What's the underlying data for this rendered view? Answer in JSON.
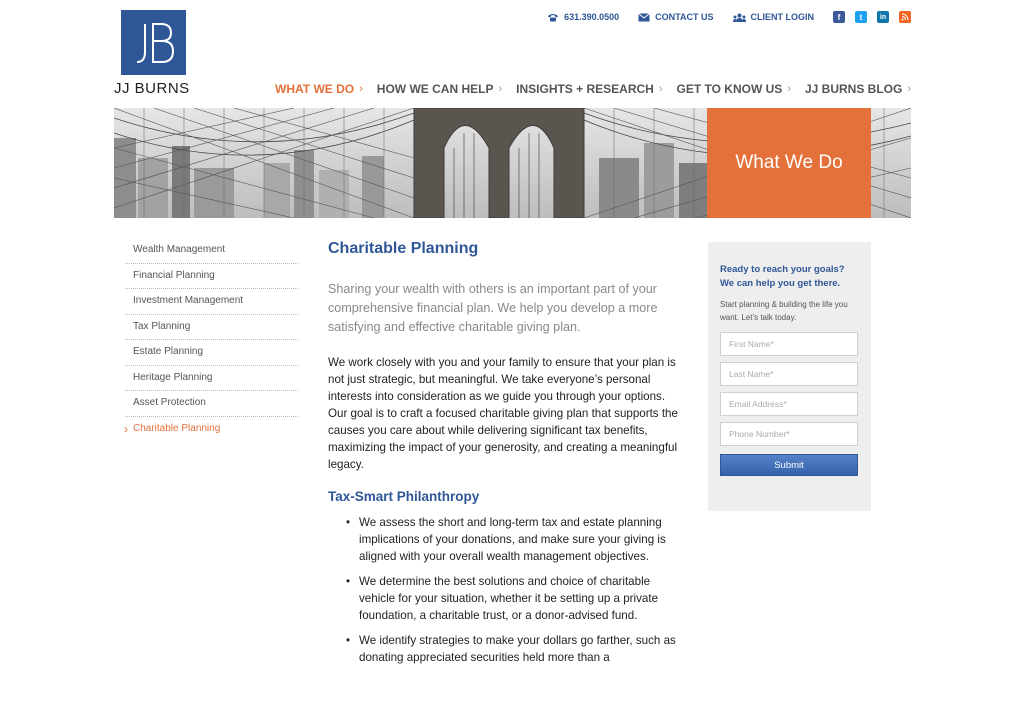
{
  "brand": {
    "name": "JJ BURNS"
  },
  "utility": {
    "phone": "631.390.0500",
    "contact": "CONTACT US",
    "client_login": "CLIENT LOGIN"
  },
  "nav": [
    {
      "label": "WHAT WE DO",
      "active": true
    },
    {
      "label": "HOW WE CAN HELP"
    },
    {
      "label": "INSIGHTS + RESEARCH"
    },
    {
      "label": "GET TO KNOW US"
    },
    {
      "label": "JJ BURNS BLOG"
    }
  ],
  "hero": {
    "title": "What We Do"
  },
  "sidebar": [
    "Wealth Management",
    "Financial Planning",
    "Investment Management",
    "Tax Planning",
    "Estate Planning",
    "Heritage Planning",
    "Asset Protection",
    "Charitable Planning"
  ],
  "content": {
    "title": "Charitable Planning",
    "intro": "Sharing your wealth with others is an important part of your comprehensive financial plan. We help you develop a more satisfying and effective charitable giving plan.",
    "body": "We work closely with you and your family to ensure that your plan is not just strategic, but meaningful. We take everyone’s personal interests into consideration as we guide you through your options. Our goal is to craft a focused charitable giving plan that supports the causes you care about while delivering significant tax benefits, maximizing the impact of your generosity, and creating a meaningful legacy.",
    "subtitle": "Tax-Smart Philanthropy",
    "bullets": [
      "We assess the short and long-term tax and estate planning implications of your donations, and make sure your giving is aligned with your overall wealth management objectives.",
      "We determine the best solutions and choice of charitable vehicle for your situation, whether it be setting up a private foundation, a charitable trust, or a donor-advised fund.",
      "We identify strategies to make your dollars go farther, such as donating appreciated securities held more than a"
    ]
  },
  "form": {
    "heading_line1": "Ready to reach your goals?",
    "heading_line2": "We can help you get there.",
    "subtext": "Start planning & building the life you want. Let’s talk today.",
    "first_name_placeholder": "First Name*",
    "last_name_placeholder": "Last Name*",
    "email_placeholder": "Email Address*",
    "phone_placeholder": "Phone Number*",
    "submit_label": "Submit"
  },
  "colors": {
    "brand_blue": "#2f5797",
    "accent_orange": "#e4703a"
  },
  "icons": {
    "phone": "phone-icon",
    "contact": "envelope-icon",
    "client_login": "users-icon",
    "social": [
      "facebook-icon",
      "twitter-icon",
      "linkedin-icon",
      "rss-icon"
    ]
  }
}
